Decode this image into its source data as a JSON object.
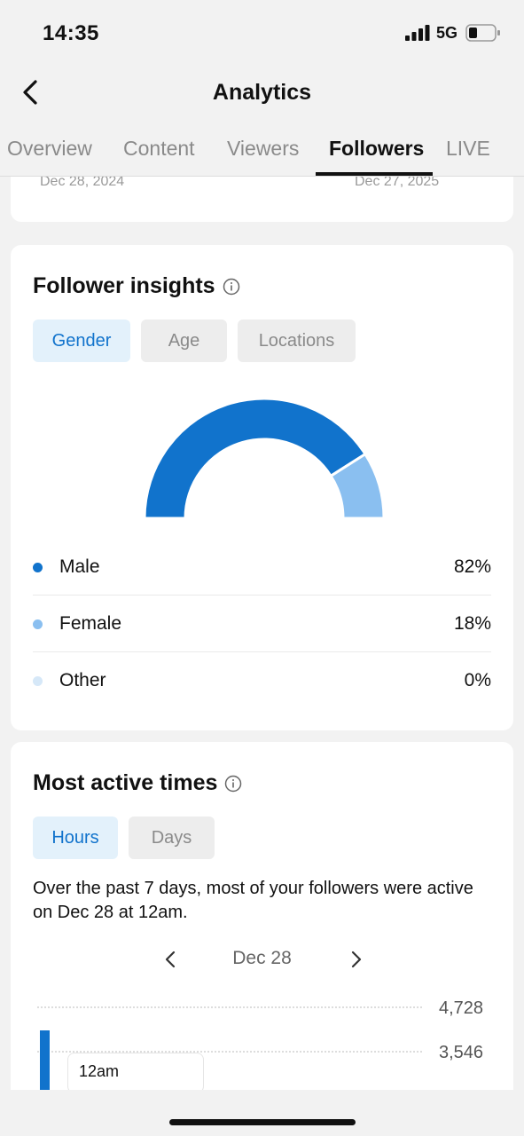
{
  "status_bar": {
    "time": "14:35",
    "network": "5G",
    "icons": [
      "signal-bars-icon",
      "battery-icon"
    ]
  },
  "header": {
    "title": "Analytics",
    "back_icon": "chevron-left-icon"
  },
  "tabs": [
    {
      "label": "Overview",
      "active": false
    },
    {
      "label": "Content",
      "active": false
    },
    {
      "label": "Viewers",
      "active": false
    },
    {
      "label": "Followers",
      "active": true
    },
    {
      "label": "LIVE",
      "active": false
    }
  ],
  "date_range": {
    "start": "Dec 28, 2024",
    "end": "Dec 27, 2025"
  },
  "follower_insights": {
    "title": "Follower insights",
    "info_icon": "info-icon",
    "filters": [
      {
        "label": "Gender",
        "selected": true
      },
      {
        "label": "Age",
        "selected": false
      },
      {
        "label": "Locations",
        "selected": false
      }
    ],
    "gender": [
      {
        "label": "Male",
        "value": "82%",
        "percent": 82,
        "color": "#1173cc"
      },
      {
        "label": "Female",
        "value": "18%",
        "percent": 18,
        "color": "#8abff0"
      },
      {
        "label": "Other",
        "value": "0%",
        "percent": 0,
        "color": "#d6e8f8"
      }
    ]
  },
  "most_active_times": {
    "title": "Most active times",
    "info_icon": "info-icon",
    "filters": [
      {
        "label": "Hours",
        "selected": true
      },
      {
        "label": "Days",
        "selected": false
      }
    ],
    "summary": "Over the past 7 days, most of your followers were active on Dec 28 at 12am.",
    "day_nav": {
      "prev_icon": "chevron-left-icon",
      "label": "Dec 28",
      "next_icon": "chevron-right-icon"
    },
    "chart_data": {
      "type": "bar",
      "y_tick_labels": [
        "4,728",
        "3,546"
      ],
      "tooltip": "12am",
      "bar_color": "#1173cc"
    }
  },
  "colors": {
    "accent": "#1173cc",
    "background": "#f2f2f2",
    "card": "#ffffff"
  }
}
